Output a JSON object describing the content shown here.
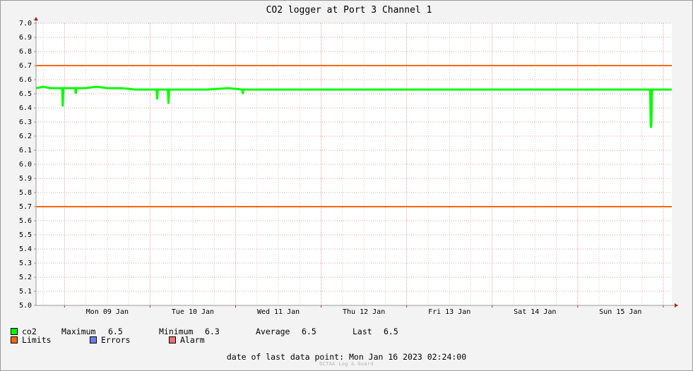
{
  "chart_data": {
    "type": "line",
    "title": "CO2 logger at Port 3 Channel 1",
    "ylim": [
      5.0,
      7.0
    ],
    "yticks": [
      "7.0",
      "6.9",
      "6.8",
      "6.7",
      "6.6",
      "6.5",
      "6.4",
      "6.3",
      "6.2",
      "6.1",
      "6.0",
      "5.9",
      "5.8",
      "5.7",
      "5.6",
      "5.5",
      "5.4",
      "5.3",
      "5.2",
      "5.1",
      "5.0"
    ],
    "xlim": [
      "2023-01-08T16:00",
      "2023-01-16T02:24"
    ],
    "xtick_labels": [
      "Mon 09 Jan",
      "Tue 10 Jan",
      "Wed 11 Jan",
      "Thu 12 Jan",
      "Fri 13 Jan",
      "Sat 14 Jan",
      "Sun 15 Jan"
    ],
    "grid": true,
    "limits": [
      6.7,
      5.7
    ],
    "series": [
      {
        "name": "co2",
        "color": "#00ff00",
        "points": [
          [
            "2023-01-08T16:00",
            6.54
          ],
          [
            "2023-01-08T18:00",
            6.55
          ],
          [
            "2023-01-08T20:00",
            6.54
          ],
          [
            "2023-01-08T22:00",
            6.54
          ],
          [
            "2023-01-08T23:20",
            6.54
          ],
          [
            "2023-01-08T23:30",
            6.41
          ],
          [
            "2023-01-08T23:40",
            6.54
          ],
          [
            "2023-01-09T03:00",
            6.54
          ],
          [
            "2023-01-09T03:10",
            6.5
          ],
          [
            "2023-01-09T03:20",
            6.54
          ],
          [
            "2023-01-09T06:00",
            6.54
          ],
          [
            "2023-01-09T09:00",
            6.55
          ],
          [
            "2023-01-09T12:00",
            6.54
          ],
          [
            "2023-01-09T16:00",
            6.54
          ],
          [
            "2023-01-09T20:00",
            6.53
          ],
          [
            "2023-01-10T00:00",
            6.53
          ],
          [
            "2023-01-10T01:50",
            6.53
          ],
          [
            "2023-01-10T02:00",
            6.46
          ],
          [
            "2023-01-10T02:10",
            6.53
          ],
          [
            "2023-01-10T05:00",
            6.53
          ],
          [
            "2023-01-10T05:10",
            6.43
          ],
          [
            "2023-01-10T05:20",
            6.53
          ],
          [
            "2023-01-10T10:00",
            6.53
          ],
          [
            "2023-01-10T16:00",
            6.53
          ],
          [
            "2023-01-10T22:00",
            6.54
          ],
          [
            "2023-01-11T01:50",
            6.53
          ],
          [
            "2023-01-11T02:00",
            6.5
          ],
          [
            "2023-01-11T02:10",
            6.53
          ],
          [
            "2023-01-11T08:00",
            6.53
          ],
          [
            "2023-01-11T16:00",
            6.53
          ],
          [
            "2023-01-12T00:00",
            6.53
          ],
          [
            "2023-01-12T08:00",
            6.53
          ],
          [
            "2023-01-12T16:00",
            6.53
          ],
          [
            "2023-01-13T00:00",
            6.53
          ],
          [
            "2023-01-13T08:00",
            6.53
          ],
          [
            "2023-01-13T16:00",
            6.53
          ],
          [
            "2023-01-14T00:00",
            6.53
          ],
          [
            "2023-01-14T08:00",
            6.53
          ],
          [
            "2023-01-14T16:00",
            6.53
          ],
          [
            "2023-01-15T00:00",
            6.53
          ],
          [
            "2023-01-15T08:00",
            6.53
          ],
          [
            "2023-01-15T16:00",
            6.53
          ],
          [
            "2023-01-15T20:20",
            6.53
          ],
          [
            "2023-01-15T20:30",
            6.26
          ],
          [
            "2023-01-15T20:40",
            6.28
          ],
          [
            "2023-01-15T20:50",
            6.53
          ],
          [
            "2023-01-16T00:00",
            6.53
          ],
          [
            "2023-01-16T02:24",
            6.53
          ]
        ]
      }
    ]
  },
  "legend": {
    "series_name": "co2",
    "maximum_label": "Maximum",
    "maximum_value": "6.5",
    "minimum_label": "Minimum",
    "minimum_value": "6.3",
    "average_label": "Average",
    "average_value": "6.5",
    "last_label": "Last",
    "last_value": "6.5",
    "limits_label": "Limits",
    "errors_label": "Errors",
    "alarm_label": "Alarm"
  },
  "colors": {
    "series": "#00ff00",
    "limits": "#ff6600",
    "errors": "#6c7cf0",
    "alarm": "#f07070",
    "grid": "#e2a6a6",
    "axis": "#9a9a9a",
    "axis_arrow": "#b02020",
    "background": "#ffffff"
  },
  "footer": {
    "last_point_label": "date of last data point:",
    "last_point_value": "Mon Jan 16 2023 02:24:00",
    "brand": "OCTAA Log & Guard"
  }
}
